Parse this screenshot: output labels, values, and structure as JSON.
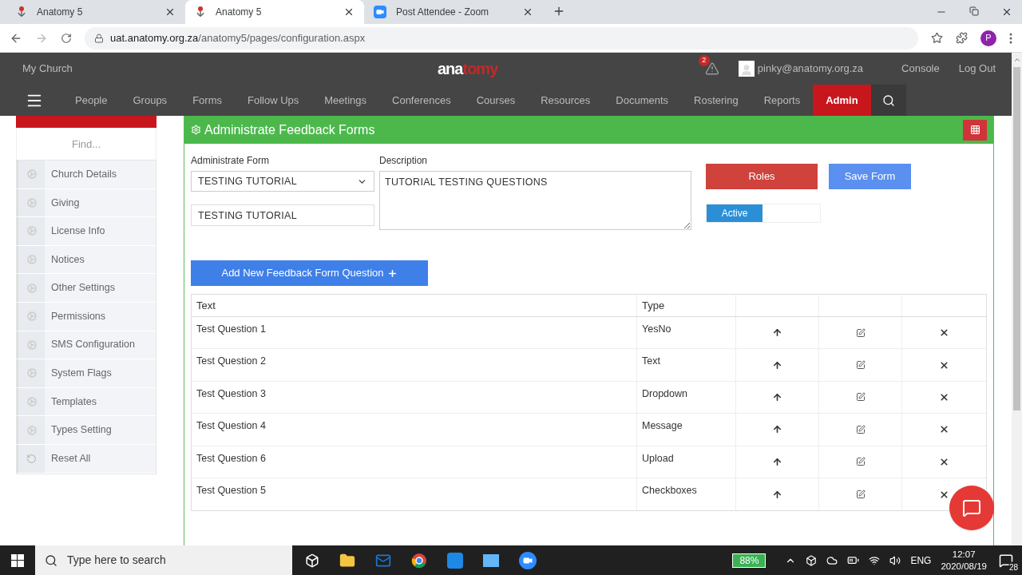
{
  "browser": {
    "tabs": [
      {
        "title": "Anatomy 5",
        "kind": "site",
        "selected": false
      },
      {
        "title": "Anatomy 5",
        "kind": "site",
        "selected": true
      },
      {
        "title": "Post Attendee - Zoom",
        "kind": "video",
        "selected": false
      }
    ],
    "url_host": "uat.anatomy.org.za",
    "url_path": "/anatomy5/pages/configuration.aspx",
    "profile_initial": "P"
  },
  "header": {
    "church": "My Church",
    "logo": [
      "ana",
      "tomy"
    ],
    "alert_count": "2",
    "user": "pinky@anatomy.org.za",
    "links": [
      "Console",
      "Log Out"
    ],
    "nav": [
      {
        "label": "People",
        "selected": false
      },
      {
        "label": "Groups",
        "selected": false
      },
      {
        "label": "Forms",
        "selected": false
      },
      {
        "label": "Follow Ups",
        "selected": false
      },
      {
        "label": "Meetings",
        "selected": false
      },
      {
        "label": "Conferences",
        "selected": false
      },
      {
        "label": "Courses",
        "selected": false
      },
      {
        "label": "Resources",
        "selected": false
      },
      {
        "label": "Documents",
        "selected": false
      },
      {
        "label": "Rostering",
        "selected": false
      },
      {
        "label": "Reports",
        "selected": false
      },
      {
        "label": "Admin",
        "selected": true
      }
    ]
  },
  "sidebar": {
    "search": {
      "placeholder": "Find..."
    },
    "items": [
      {
        "label": "Church Details",
        "kind": "setting"
      },
      {
        "label": "Giving",
        "kind": "setting"
      },
      {
        "label": "License Info",
        "kind": "setting"
      },
      {
        "label": "Notices",
        "kind": "setting"
      },
      {
        "label": "Other Settings",
        "kind": "setting"
      },
      {
        "label": "Permissions",
        "kind": "setting"
      },
      {
        "label": "SMS Configuration",
        "kind": "setting"
      },
      {
        "label": "System Flags",
        "kind": "setting"
      },
      {
        "label": "Templates",
        "kind": "setting"
      },
      {
        "label": "Types Setting",
        "kind": "setting"
      },
      {
        "label": "Reset All",
        "kind": "reset"
      }
    ]
  },
  "panel": {
    "title": "Administrate Feedback Forms",
    "form_label": "Administrate Form",
    "form_select": "TESTING TUTORIAL",
    "form_name": "TESTING TUTORIAL",
    "description_label": "Description",
    "description": "TUTORIAL TESTING QUESTIONS",
    "roles_button": "Roles",
    "save_button": "Save Form",
    "active_toggle": {
      "label": "Active",
      "on": true
    },
    "add_button": "Add New Feedback Form Question",
    "table": {
      "columns": [
        "Text",
        "Type"
      ],
      "rows": [
        {
          "text": "Test Question 1",
          "type": "YesNo"
        },
        {
          "text": "Test Question 2",
          "type": "Text"
        },
        {
          "text": "Test Question 3",
          "type": "Dropdown"
        },
        {
          "text": "Test Question 4",
          "type": "Message"
        },
        {
          "text": "Test Question 6",
          "type": "Upload"
        },
        {
          "text": "Test Question 5",
          "type": "Checkboxes"
        }
      ]
    }
  },
  "taskbar": {
    "search_placeholder": "Type here to search",
    "battery": "88%",
    "language": "ENG",
    "time": "12:07",
    "date": "2020/08/19",
    "notifications": "28"
  }
}
